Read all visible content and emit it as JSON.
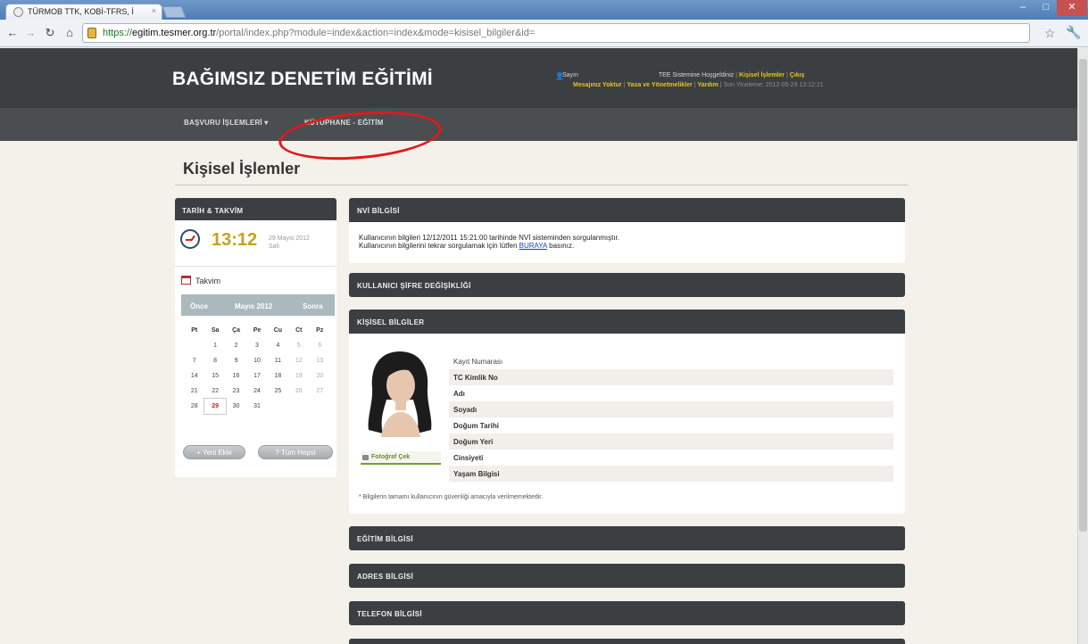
{
  "browser": {
    "tab_title": "TÜRMOB TTK, KOBİ-TFRS, İ",
    "url_scheme": "https://",
    "url_host": "egitim.tesmer.org.tr",
    "url_path": "/portal/index.php?module=index&action=index&mode=kisisel_bilgiler&id="
  },
  "header": {
    "site_title": "BAĞIMSIZ DENETİM EĞİTİMİ",
    "greeting_prefix": "Sayın",
    "welcome": "TEE Sistemine Hoşgeldiniz",
    "link_personal": "Kişisel İşlemler",
    "link_logout": "Çıkış",
    "link_messages": "Mesajınız Yoktur",
    "link_laws": "Yasa ve Yönetmelikler",
    "link_help": "Yardım",
    "last_update": "Son Yineleme: 2012-05-29 13:12:21"
  },
  "menu": {
    "item1": "BAŞVURU İŞLEMLERİ",
    "item2": "KÜTÜPHANE - EĞİTİM"
  },
  "page": {
    "title": "Kişisel İşlemler"
  },
  "sidebar": {
    "heading": "TARİH & TAKVİM",
    "time": "13:12",
    "date_line1": "29 Mayıs 2012",
    "date_line2": "Salı",
    "calendar_label": "Takvim",
    "prev": "Önce",
    "month": "Mayıs 2012",
    "next": "Sonra",
    "weekdays": [
      "Pt",
      "Sa",
      "Ça",
      "Pe",
      "Cu",
      "Ct",
      "Pz"
    ],
    "weeks": [
      [
        "",
        "1",
        "2",
        "3",
        "4",
        "5",
        "6"
      ],
      [
        "7",
        "8",
        "9",
        "10",
        "11",
        "12",
        "13"
      ],
      [
        "14",
        "15",
        "16",
        "17",
        "18",
        "19",
        "20"
      ],
      [
        "21",
        "22",
        "23",
        "24",
        "25",
        "26",
        "27"
      ],
      [
        "28",
        "29",
        "30",
        "31",
        "",
        "",
        ""
      ]
    ],
    "today": "29",
    "btn_new": "+ Yeni Ekle",
    "btn_all": "? Tüm Hepsi"
  },
  "panels": {
    "nvi_title": "NVİ BİLGİSİ",
    "nvi_line1": "Kullanıcının bilgileri 12/12/2011 15:21:00 tarihinde NVİ sisteminden sorgulanmıştır.",
    "nvi_line2_prefix": "Kullanıcının bilgilerini tekrar sorgulamak için lütfen",
    "nvi_link": "BURAYA",
    "nvi_line2_suffix": "basınız.",
    "password_title": "KULLANICI ŞİFRE DEĞİŞİKLİĞİ",
    "personal_title": "KİŞİSEL BİLGİLER",
    "photo_button": "Fotoğraf Çek",
    "fields": [
      "Kayıt Numarası",
      "TC Kimlik No",
      "Adı",
      "Soyadı",
      "Doğum Tarihi",
      "Doğum Yeri",
      "Cinsiyeti",
      "Yaşam Bilgisi"
    ],
    "footnote": "* Bilgilerin tamamı kullanıcının güvenliği amacıyla verilmemektedir.",
    "education_title": "EĞİTİM BİLGİSİ",
    "address_title": "ADRES BİLGİSİ",
    "phone_title": "TELEFON BİLGİSİ"
  }
}
